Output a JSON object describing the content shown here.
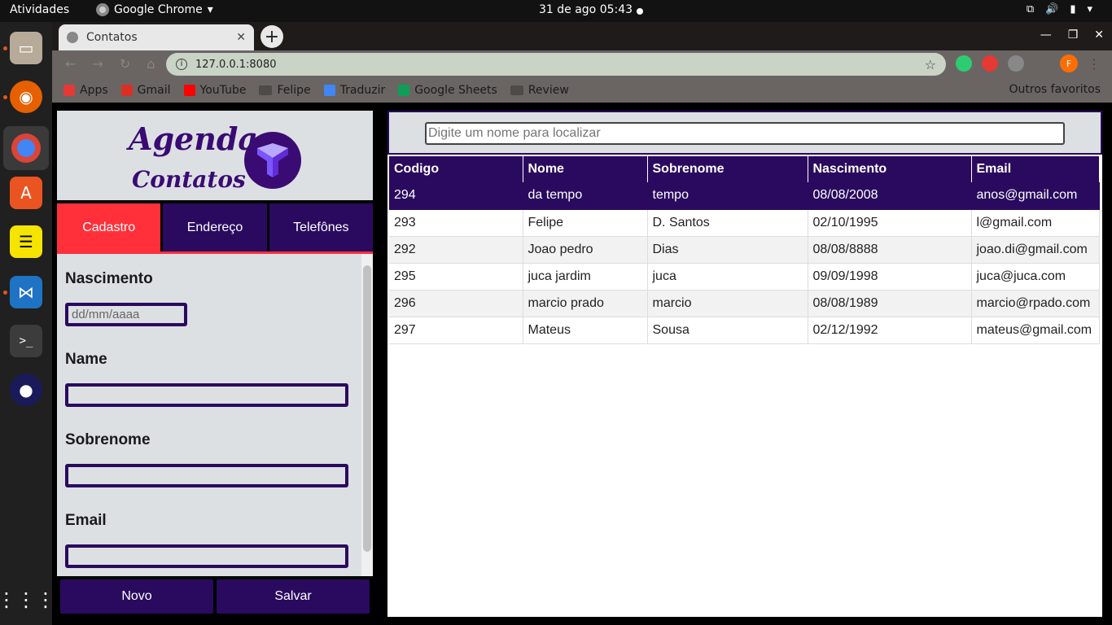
{
  "topbar": {
    "activities": "Atividades",
    "app": "Google Chrome",
    "clock": "31 de ago  05:43"
  },
  "browser": {
    "tab_title": "Contatos",
    "url": "127.0.0.1:8080",
    "profile_initial": "F",
    "bookmarks": [
      {
        "label": "Apps",
        "color": "#e53935"
      },
      {
        "label": "Gmail",
        "color": "#d93025"
      },
      {
        "label": "YouTube",
        "color": "#ff0000"
      },
      {
        "label": "Felipe",
        "color": "folder"
      },
      {
        "label": "Traduzir",
        "color": "#4285f4"
      },
      {
        "label": "Google Sheets",
        "color": "#0f9d58"
      },
      {
        "label": "Review",
        "color": "folder"
      }
    ],
    "other_bookmarks": "Outros favoritos"
  },
  "app": {
    "logo_line1": "Agenda",
    "logo_line2": "Contatos",
    "tabs": [
      "Cadastro",
      "Endereço",
      "Telefônes"
    ],
    "active_tab": "Cadastro",
    "form": {
      "nascimento_label": "Nascimento",
      "nascimento_placeholder": "dd/mm/aaaa",
      "name_label": "Name",
      "sobrenome_label": "Sobrenome",
      "email_label": "Email"
    },
    "buttons": {
      "novo": "Novo",
      "salvar": "Salvar"
    },
    "search_placeholder": "Digite um nome para localizar",
    "table": {
      "headers": [
        "Codigo",
        "Nome",
        "Sobrenome",
        "Nascimento",
        "Email"
      ],
      "rows": [
        [
          "294",
          "da tempo",
          "tempo",
          "08/08/2008",
          "anos@gmail.com"
        ],
        [
          "293",
          "Felipe",
          "D. Santos",
          "02/10/1995",
          "l@gmail.com"
        ],
        [
          "292",
          "Joao pedro",
          "Dias",
          "08/08/8888",
          "joao.di@gmail.com"
        ],
        [
          "295",
          "juca jardim",
          "juca",
          "09/09/1998",
          "juca@juca.com"
        ],
        [
          "296",
          "marcio prado",
          "marcio",
          "08/08/1989",
          "marcio@rpado.com"
        ],
        [
          "297",
          "Mateus",
          "Sousa",
          "02/12/1992",
          "mateus@gmail.com"
        ]
      ]
    },
    "colors": {
      "primary": "#2a0a5e",
      "active_tab": "#ff3039",
      "panel_bg": "#dde0e3"
    }
  }
}
